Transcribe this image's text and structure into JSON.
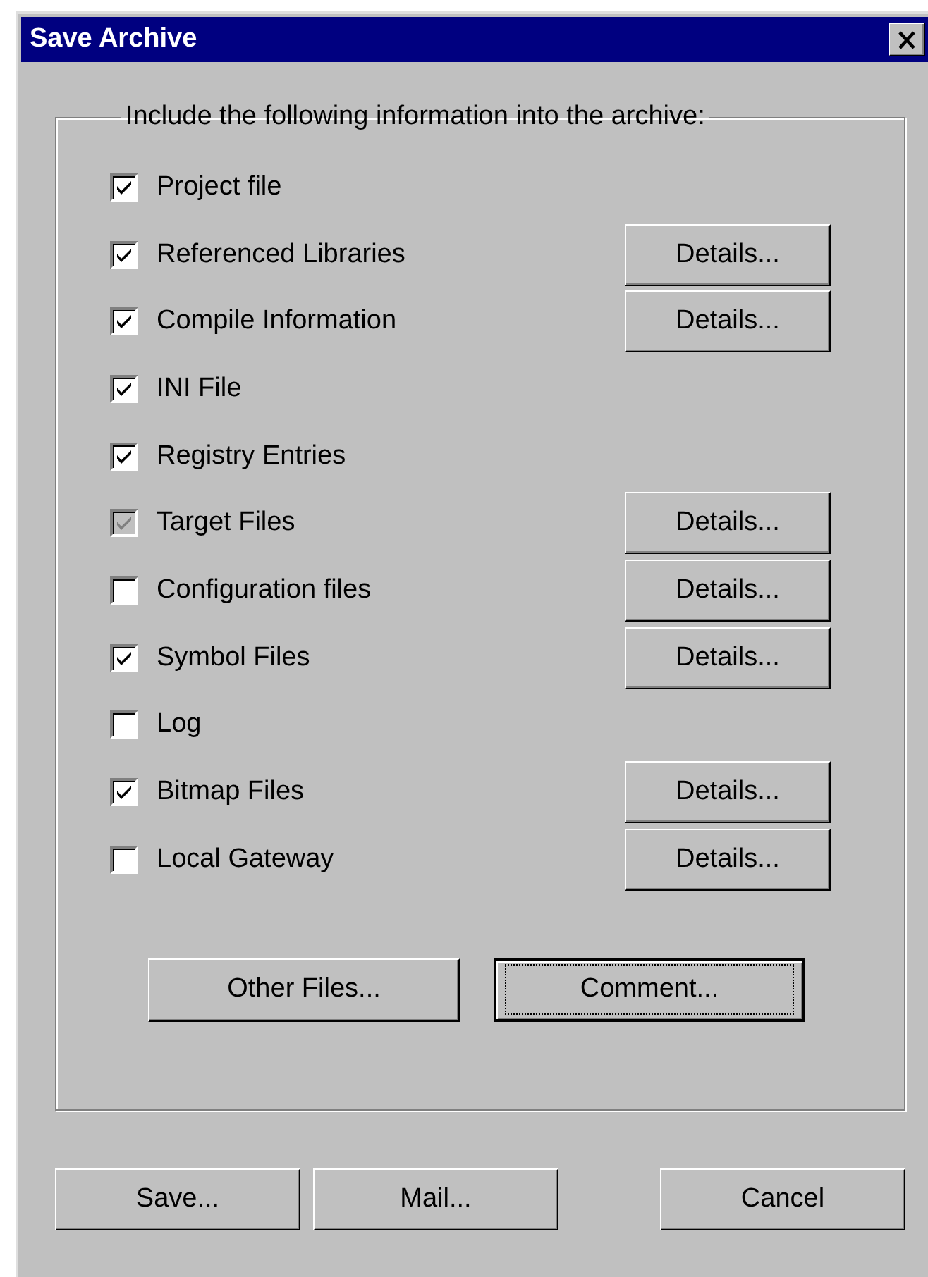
{
  "window": {
    "title": "Save Archive"
  },
  "group": {
    "caption": "Include the following information into the archive:"
  },
  "options": [
    {
      "label": "Project file",
      "checked": true,
      "disabled": false
    },
    {
      "label": "Referenced Libraries",
      "checked": true,
      "disabled": false,
      "details": "Details..."
    },
    {
      "label": "Compile Information",
      "checked": true,
      "disabled": false,
      "details": "Details..."
    },
    {
      "label": "INI File",
      "checked": true,
      "disabled": false
    },
    {
      "label": "Registry Entries",
      "checked": true,
      "disabled": false
    },
    {
      "label": "Target Files",
      "checked": true,
      "disabled": true,
      "details": "Details..."
    },
    {
      "label": "Configuration files",
      "checked": false,
      "disabled": false,
      "details": "Details..."
    },
    {
      "label": "Symbol Files",
      "checked": true,
      "disabled": false,
      "details": "Details..."
    },
    {
      "label": "Log",
      "checked": false,
      "disabled": false
    },
    {
      "label": "Bitmap Files",
      "checked": true,
      "disabled": false,
      "details": "Details..."
    },
    {
      "label": "Local Gateway",
      "checked": false,
      "disabled": false,
      "details": "Details..."
    }
  ],
  "group_buttons": [
    {
      "label": "Other Files...",
      "focused": false
    },
    {
      "label": "Comment...",
      "focused": true
    }
  ],
  "footer_buttons": [
    {
      "label": "Save...",
      "focused": false
    },
    {
      "label": "Mail...",
      "focused": false
    },
    {
      "label": "Cancel",
      "focused": false
    }
  ]
}
